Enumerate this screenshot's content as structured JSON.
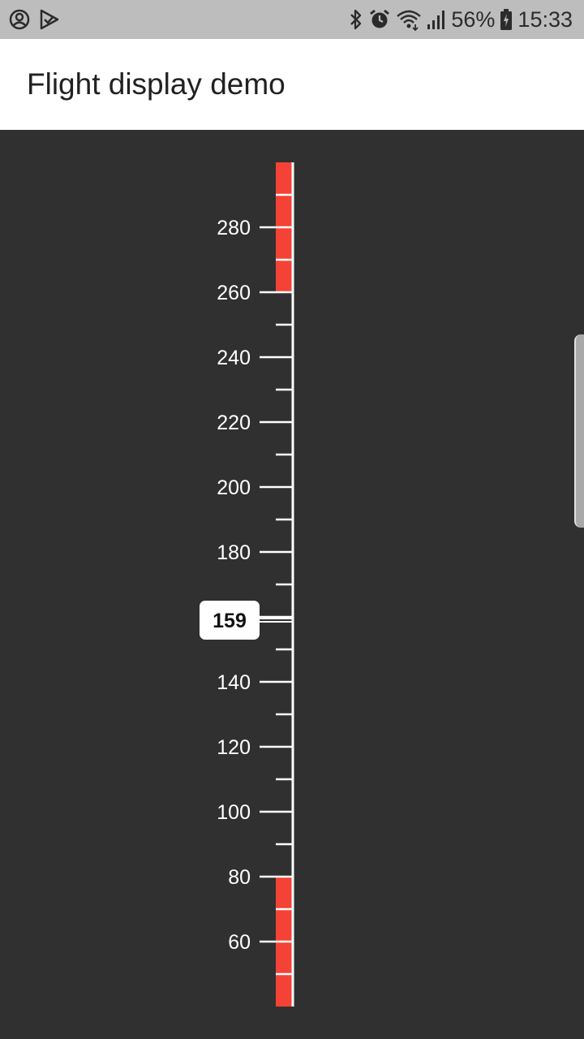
{
  "status_bar": {
    "battery_percent": "56%",
    "time": "15:33",
    "left_icons": [
      "account-circle-icon",
      "play-check-icon"
    ],
    "right_icons": [
      "bluetooth-icon",
      "alarm-icon",
      "wifi-icon",
      "signal-icon",
      "battery-charging-icon"
    ]
  },
  "app_bar": {
    "title": "Flight display demo"
  },
  "chart_data": {
    "type": "airspeed-tape",
    "visible_range": [
      40,
      300
    ],
    "major_step": 20,
    "minor_step": 10,
    "labels": [
      "60",
      "80",
      "100",
      "120",
      "140",
      "160",
      "180",
      "200",
      "220",
      "240",
      "260",
      "280"
    ],
    "label_values": [
      60,
      80,
      100,
      120,
      140,
      160,
      180,
      200,
      220,
      240,
      260,
      280
    ],
    "danger_bands": [
      {
        "from": 40,
        "to": 80,
        "color": "#f44336"
      },
      {
        "from": 260,
        "to": 300,
        "color": "#f44336"
      }
    ],
    "current_value": 159,
    "current_label": "159"
  },
  "colors": {
    "background": "#303030",
    "danger": "#f44336",
    "tick": "#ffffff",
    "status_bar": "#bdbdbd",
    "app_bar": "#ffffff"
  }
}
